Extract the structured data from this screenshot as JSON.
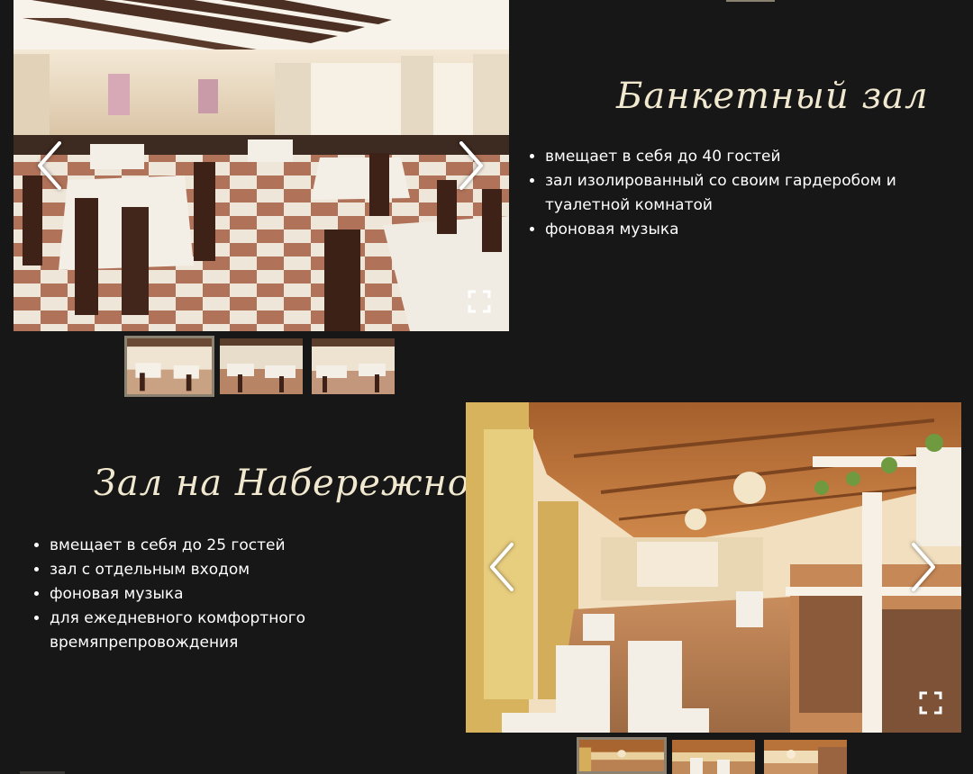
{
  "halls": [
    {
      "title": "Банкетный зал",
      "features": [
        "вмещает в себя до 40 гостей",
        "зал изолированный со своим гардеробом и туалетной комнатой",
        "фоновая музыка"
      ],
      "gallery": {
        "thumbnail_count": 3,
        "active_index": 0
      }
    },
    {
      "title": "Зал на Набережной",
      "features": [
        "вмещает в себя до 25 гостей",
        "зал с отдельным входом",
        "фоновая музыка",
        "для ежедневного комфортного времяпрепровождения"
      ],
      "gallery": {
        "thumbnail_count": 3,
        "active_index": 0
      }
    }
  ],
  "icons": {
    "prev": "chevron-left-icon",
    "next": "chevron-right-icon",
    "fullscreen": "fullscreen-icon"
  },
  "colors": {
    "background": "#181717",
    "title": "#f1e8d0",
    "text": "#ffffff",
    "thumb_active_border": "#8b8272"
  }
}
